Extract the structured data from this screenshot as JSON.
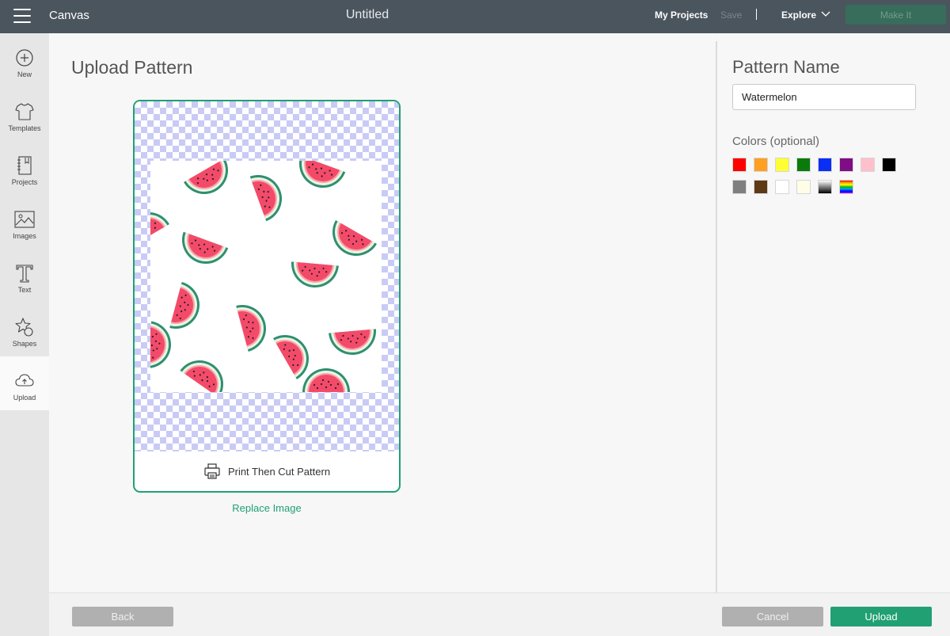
{
  "topbar": {
    "app_name": "Canvas",
    "doc_title": "Untitled",
    "my_projects": "My Projects",
    "save": "Save",
    "explore": "Explore",
    "make_it": "Make It"
  },
  "sidebar": {
    "items": [
      {
        "label": "New",
        "icon": "plus-circle-icon"
      },
      {
        "label": "Templates",
        "icon": "tshirt-icon"
      },
      {
        "label": "Projects",
        "icon": "notebook-icon"
      },
      {
        "label": "Images",
        "icon": "image-icon"
      },
      {
        "label": "Text",
        "icon": "text-icon"
      },
      {
        "label": "Shapes",
        "icon": "shapes-icon"
      },
      {
        "label": "Upload",
        "icon": "cloud-upload-icon",
        "active": true
      }
    ]
  },
  "main": {
    "title": "Upload Pattern",
    "card_footer": "Print Then Cut Pattern",
    "replace_link": "Replace Image"
  },
  "right": {
    "pattern_name_title": "Pattern Name",
    "pattern_name_value": "Watermelon",
    "colors_title": "Colors (optional)",
    "swatches": [
      {
        "name": "red",
        "color": "#ff0000"
      },
      {
        "name": "orange",
        "color": "#ffa024"
      },
      {
        "name": "yellow",
        "color": "#ffff33"
      },
      {
        "name": "green",
        "color": "#0a7a0a"
      },
      {
        "name": "blue",
        "color": "#0a2ef5"
      },
      {
        "name": "purple",
        "color": "#7f0d85"
      },
      {
        "name": "pink",
        "color": "#ffc0cb"
      },
      {
        "name": "black",
        "color": "#000000"
      },
      {
        "name": "gray",
        "color": "#7f7f7f"
      },
      {
        "name": "brown",
        "color": "#5e3a16"
      },
      {
        "name": "white",
        "color": "#ffffff"
      },
      {
        "name": "cream",
        "color": "#fffde6"
      },
      {
        "name": "black-gradient",
        "color": "gradient-bw"
      },
      {
        "name": "rainbow",
        "color": "gradient-rainbow"
      }
    ]
  },
  "bottombar": {
    "back": "Back",
    "cancel": "Cancel",
    "upload": "Upload"
  },
  "colors": {
    "accent": "#21a074",
    "topbar": "#4b555e"
  }
}
